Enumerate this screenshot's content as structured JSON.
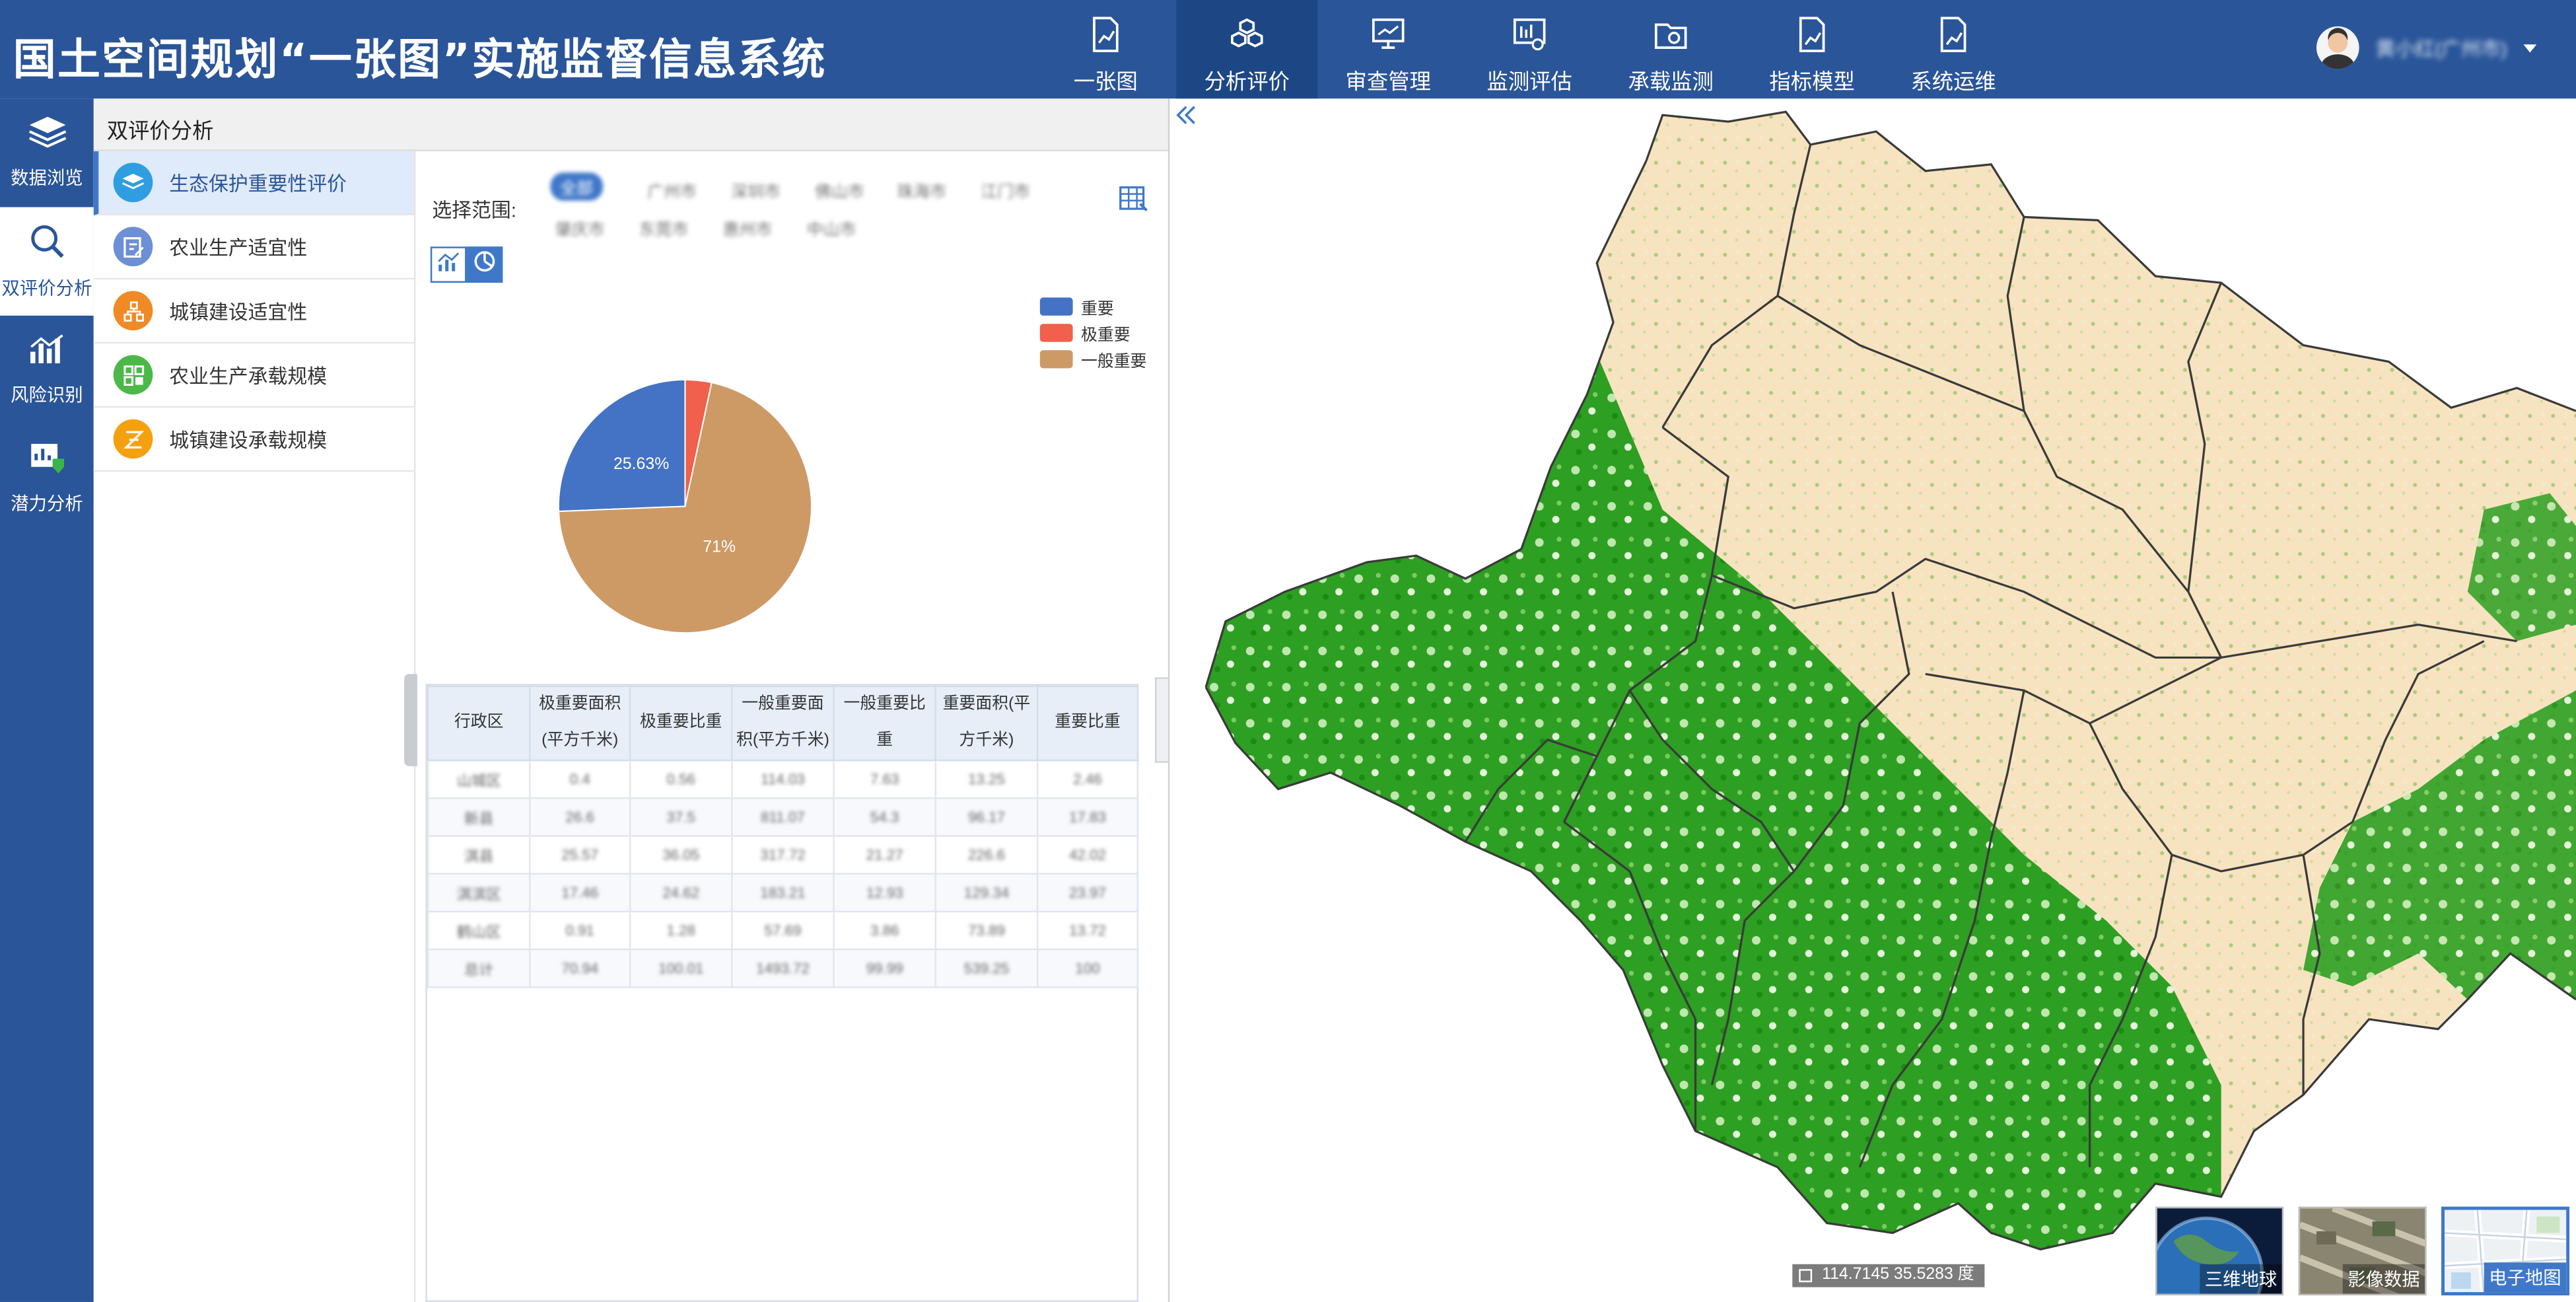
{
  "header": {
    "title": "国土空间规划“一张图”实施监督信息系统",
    "nav": [
      {
        "label": "一张图",
        "icon": "map-doc-icon"
      },
      {
        "label": "分析评价",
        "icon": "cubes-icon"
      },
      {
        "label": "审查管理",
        "icon": "monitor-chart-icon"
      },
      {
        "label": "监测评估",
        "icon": "monitor-eye-icon"
      },
      {
        "label": "承载监测",
        "icon": "folder-gear-icon"
      },
      {
        "label": "指标模型",
        "icon": "doc-chart-icon"
      },
      {
        "label": "系统运维",
        "icon": "doc-chart-icon"
      }
    ],
    "active_nav": "分析评价",
    "user_name": "黄小红(广州市)"
  },
  "rail": [
    {
      "label": "数据浏览",
      "icon": "layers-icon"
    },
    {
      "label": "双评价分析",
      "icon": "search-icon"
    },
    {
      "label": "风险识别",
      "icon": "bar-chart-icon"
    },
    {
      "label": "潜力分析",
      "icon": "shield-chart-icon"
    }
  ],
  "panel": {
    "title": "双评价分析",
    "submenu": [
      {
        "label": "生态保护重要性评价",
        "icon": "layers-icon",
        "color": "#2f9ee0"
      },
      {
        "label": "农业生产适宜性",
        "icon": "edit-icon",
        "color": "#6c8fd6"
      },
      {
        "label": "城镇建设适宜性",
        "icon": "org-icon",
        "color": "#f08a24"
      },
      {
        "label": "农业生产承载规模",
        "icon": "grid-icon",
        "color": "#4cb848"
      },
      {
        "label": "城镇建设承载规模",
        "icon": "z-icon",
        "color": "#f5a10f"
      }
    ],
    "range_label": "选择范围:",
    "range_options": [
      "全部",
      "广州市",
      "深圳市",
      "佛山市",
      "珠海市",
      "江门市",
      "肇庆市",
      "东莞市",
      "惠州市",
      "中山市"
    ],
    "selected_range": "全部"
  },
  "legend": [
    {
      "label": "重要",
      "color": "#4472c4"
    },
    {
      "label": "极重要",
      "color": "#f0604c"
    },
    {
      "label": "一般重要",
      "color": "#cd9a66"
    }
  ],
  "chart_data": {
    "type": "pie",
    "slices": [
      {
        "name": "重要",
        "value": 25.63,
        "color": "#4472c4",
        "label": "25.63%"
      },
      {
        "name": "极重要",
        "value": 3.37,
        "color": "#f0604c",
        "label": ""
      },
      {
        "name": "一般重要",
        "value": 71,
        "color": "#cd9a66",
        "label": "71%"
      }
    ]
  },
  "table": {
    "headers": [
      "行政区",
      "极重要面积(平方千米)",
      "极重要比重",
      "一般重要面积(平方千米)",
      "一般重要比重",
      "重要面积(平方千米)",
      "重要比重"
    ],
    "rows": [
      [
        "山城区",
        "0.4",
        "0.56",
        "114.03",
        "7.63",
        "13.25",
        "2.46"
      ],
      [
        "新县",
        "26.6",
        "37.5",
        "811.07",
        "54.3",
        "96.17",
        "17.83"
      ],
      [
        "淇县",
        "25.57",
        "36.05",
        "317.72",
        "21.27",
        "226.6",
        "42.02"
      ],
      [
        "淇滨区",
        "17.46",
        "24.62",
        "183.21",
        "12.93",
        "129.34",
        "23.97"
      ],
      [
        "鹤山区",
        "0.91",
        "1.28",
        "57.69",
        "3.86",
        "73.89",
        "13.72"
      ],
      [
        "总计",
        "70.94",
        "100.01",
        "1493.72",
        "99.99",
        "539.25",
        "100"
      ]
    ]
  },
  "map": {
    "coordinate": "114.7145 35.5283 度",
    "colors": {
      "low": "#f7e3bf",
      "high": "#1f9a18",
      "boundary": "#3a3a3a"
    },
    "basemaps": [
      {
        "label": "三维地球"
      },
      {
        "label": "影像数据"
      },
      {
        "label": "电子地图"
      }
    ],
    "active_basemap": "电子地图"
  }
}
